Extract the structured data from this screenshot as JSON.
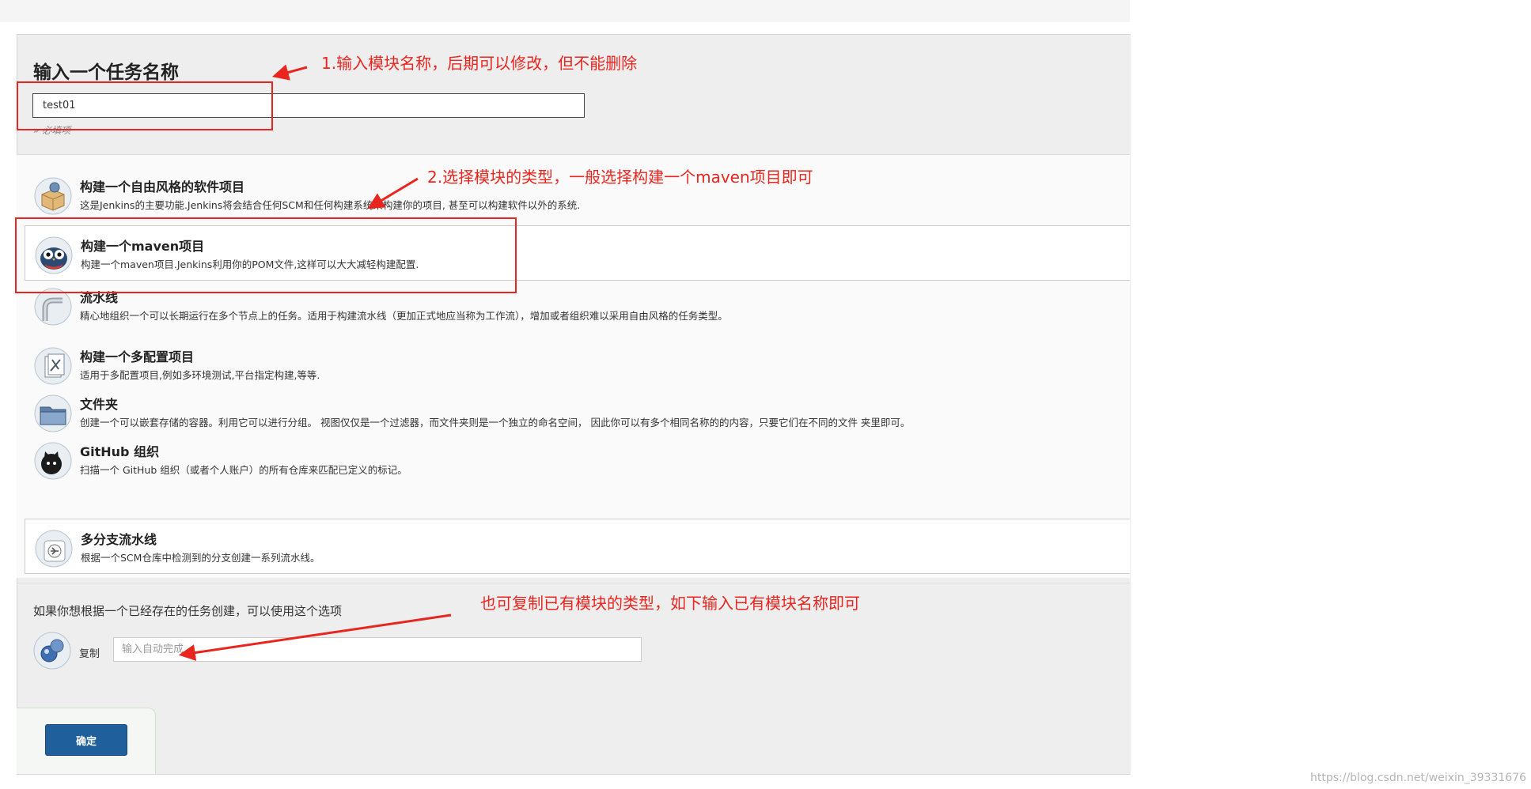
{
  "name_section": {
    "title": "输入一个任务名称",
    "input_value": "test01",
    "required_hint": "» 必填项"
  },
  "project_types": [
    {
      "icon": "freestyle-box-icon",
      "title": "构建一个自由风格的软件项目",
      "description": "这是Jenkins的主要功能.Jenkins将会结合任何SCM和任何构建系统来构建你的项目, 甚至可以构建软件以外的系统.",
      "selected": false
    },
    {
      "icon": "maven-owl-icon",
      "title": "构建一个maven项目",
      "description": "构建一个maven项目.Jenkins利用你的POM文件,这样可以大大减轻构建配置.",
      "selected": true
    },
    {
      "icon": "pipeline-icon",
      "title": "流水线",
      "description": "精心地组织一个可以长期运行在多个节点上的任务。适用于构建流水线（更加正式地应当称为工作流），增加或者组织难以采用自由风格的任务类型。",
      "selected": false
    },
    {
      "icon": "multi-config-icon",
      "title": "构建一个多配置项目",
      "description": "适用于多配置项目,例如多环境测试,平台指定构建,等等.",
      "selected": false
    },
    {
      "icon": "folder-icon",
      "title": "文件夹",
      "description": "创建一个可以嵌套存储的容器。利用它可以进行分组。 视图仅仅是一个过滤器，而文件夹则是一个独立的命名空间， 因此你可以有多个相同名称的的内容，只要它们在不同的文件 夹里即可。",
      "selected": false
    },
    {
      "icon": "github-org-icon",
      "title": "GitHub 组织",
      "description": "扫描一个 GitHub 组织（或者个人账户）的所有仓库来匹配已定义的标记。",
      "selected": false
    },
    {
      "icon": "multibranch-pipeline-icon",
      "title": "多分支流水线",
      "description": "根据一个SCM仓库中检测到的分支创建一系列流水线。",
      "selected": false
    }
  ],
  "copy_section": {
    "hint": "如果你想根据一个已经存在的任务创建，可以使用这个选项",
    "label": "复制",
    "placeholder": "输入自动完成"
  },
  "ok_button": "确定",
  "annotations": {
    "a1": "1.输入模块名称，后期可以修改，但不能删除",
    "a2": "2.选择模块的类型，一般选择构建一个maven项目即可",
    "a3": "也可复制已有模块的类型，如下输入已有模块名称即可"
  },
  "watermark": "https://blog.csdn.net/weixin_39331676",
  "colors": {
    "annotation_red": "#e8261f",
    "ok_button": "#1f5f9c",
    "panel": "#eeeeee"
  }
}
